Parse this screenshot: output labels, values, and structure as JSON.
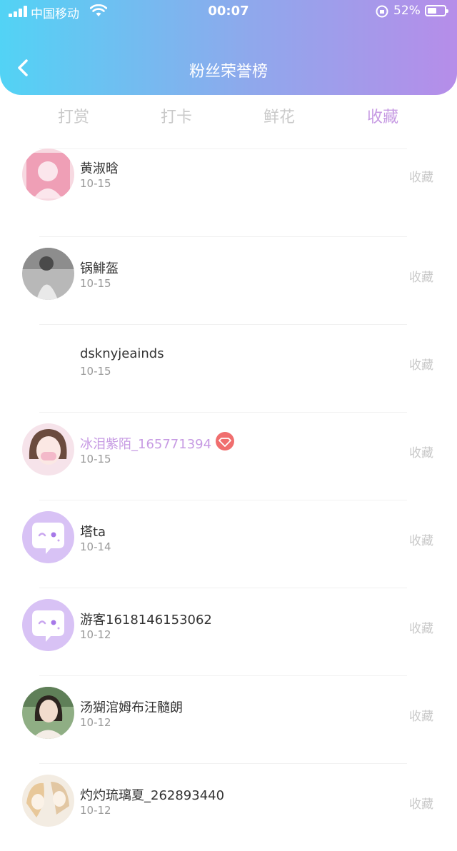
{
  "status_bar": {
    "carrier": "中国移动",
    "time": "00:07",
    "battery": "52%"
  },
  "header": {
    "title": "粉丝荣誉榜"
  },
  "tabs": [
    {
      "label": "打赏",
      "active": false
    },
    {
      "label": "打卡",
      "active": false
    },
    {
      "label": "鲜花",
      "active": false
    },
    {
      "label": "收藏",
      "active": true
    }
  ],
  "colors": {
    "accent": "#c79be3",
    "gradient_start": "#52d3f5",
    "gradient_end": "#b68de9",
    "vip_badge": "#f06e6e"
  },
  "fans": [
    {
      "name": "黄淑晗",
      "date": "10-15",
      "action": "收藏"
    },
    {
      "name": "锅鯡盔",
      "date": "10-15",
      "action": "收藏"
    },
    {
      "name": "dsknyjeainds",
      "date": "10-15",
      "action": "收藏"
    },
    {
      "name": "冰泪紫陌_165771394",
      "date": "10-15",
      "action": "收藏"
    },
    {
      "name": "塔ta",
      "date": "10-14",
      "action": "收藏"
    },
    {
      "name": "游客1618146153062",
      "date": "10-12",
      "action": "收藏"
    },
    {
      "name": "汤猢涫姆布汪髓朗",
      "date": "10-12",
      "action": "收藏"
    },
    {
      "name": "灼灼琉璃夏_262893440",
      "date": "10-12",
      "action": "收藏"
    }
  ]
}
